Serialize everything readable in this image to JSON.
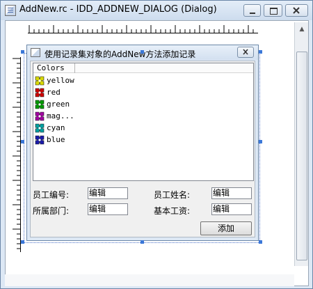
{
  "window": {
    "title": "AddNew.rc - IDD_ADDNEW_DIALOG (Dialog)",
    "minimize_icon": "minimize-icon",
    "maximize_icon": "maximize-icon",
    "close_icon": "close-icon"
  },
  "dialog": {
    "title": "使用记录集对象的AddNew方法添加记录",
    "close_icon": "close-icon"
  },
  "listview": {
    "column": "Colors",
    "items": [
      {
        "label": "yellow",
        "color": "#d7d700"
      },
      {
        "label": "red",
        "color": "#cc0000"
      },
      {
        "label": "green",
        "color": "#009900"
      },
      {
        "label": "mag...",
        "color": "#a000a0"
      },
      {
        "label": "cyan",
        "color": "#00a0a0"
      },
      {
        "label": "blue",
        "color": "#1a1aa8"
      }
    ]
  },
  "form": {
    "employee_id_label": "员工编号:",
    "employee_id_value": "编辑",
    "employee_name_label": "员工姓名:",
    "employee_name_value": "编辑",
    "department_label": "所属部门:",
    "department_value": "编辑",
    "salary_label": "基本工资:",
    "salary_value": "编辑",
    "add_button": "添加"
  }
}
